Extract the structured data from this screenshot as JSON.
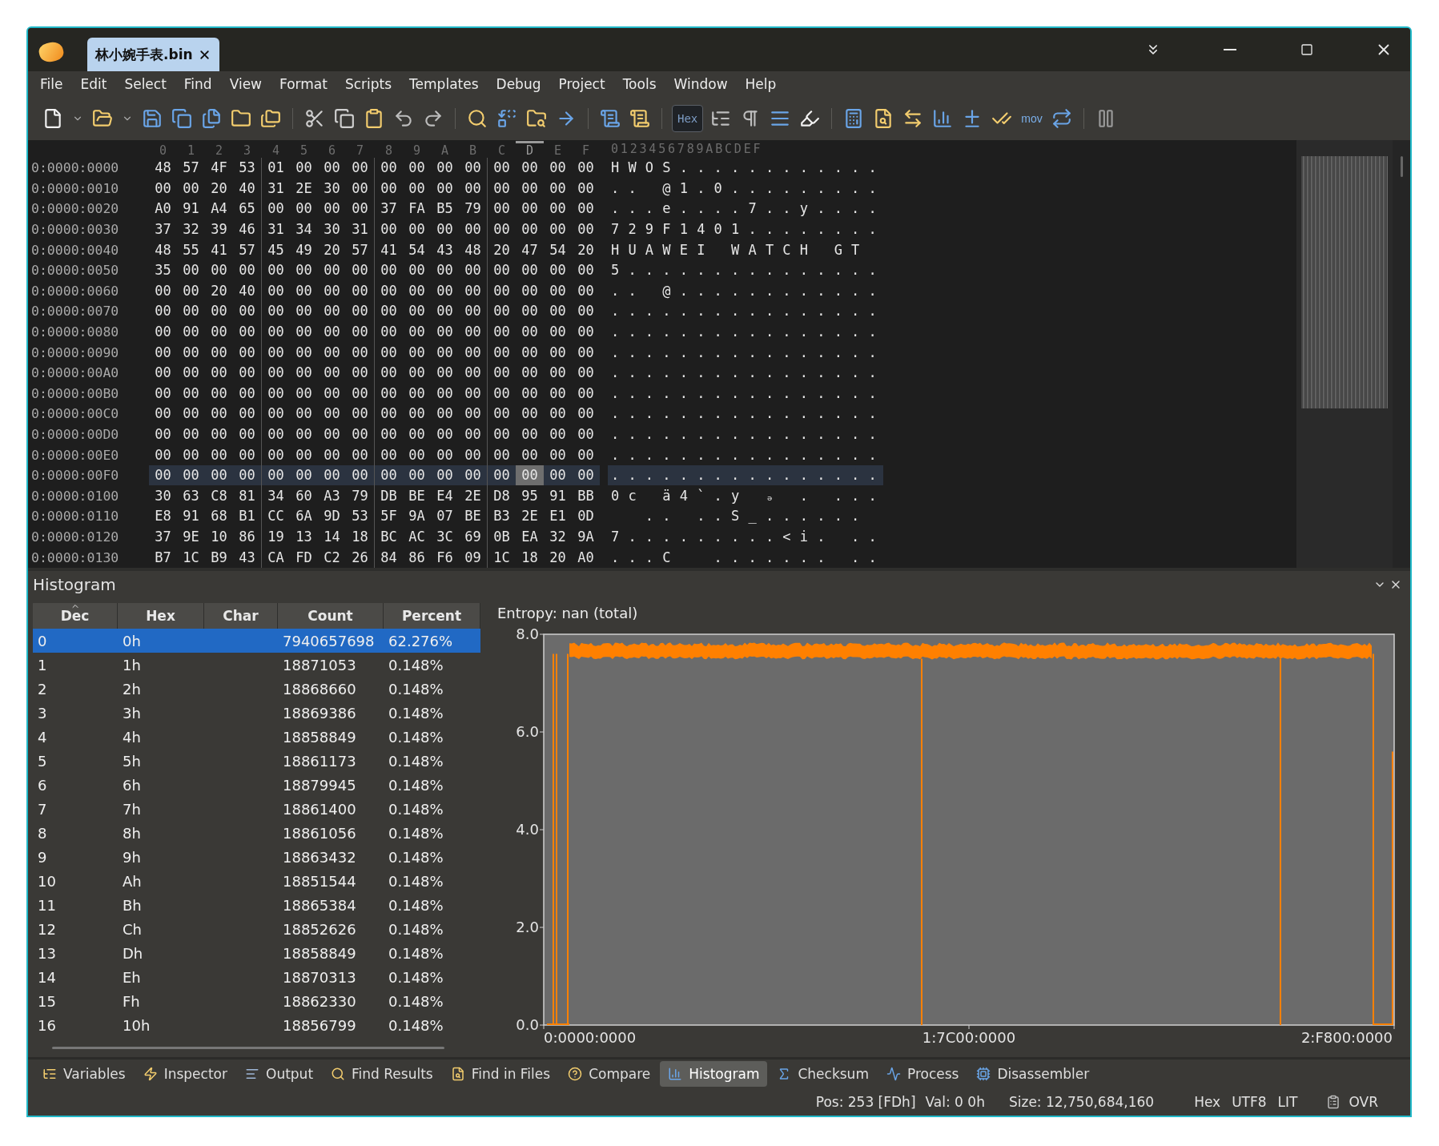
{
  "window": {
    "tab": {
      "title": "林小婉手表.bin",
      "selected": true
    }
  },
  "menu": [
    "File",
    "Edit",
    "Select",
    "Find",
    "View",
    "Format",
    "Scripts",
    "Templates",
    "Debug",
    "Project",
    "Tools",
    "Window",
    "Help"
  ],
  "toolbar": {
    "hex_button": {
      "label": "Hex",
      "on": true
    },
    "mov_label": "mov"
  },
  "hex_view": {
    "header": [
      {
        "label": "0",
        "selected": false
      },
      {
        "label": "1",
        "selected": false
      },
      {
        "label": "2",
        "selected": false
      },
      {
        "label": "3",
        "selected": false
      },
      {
        "label": "4",
        "selected": false
      },
      {
        "label": "5",
        "selected": false
      },
      {
        "label": "6",
        "selected": false
      },
      {
        "label": "7",
        "selected": false
      },
      {
        "label": "8",
        "selected": false
      },
      {
        "label": "9",
        "selected": false
      },
      {
        "label": "A",
        "selected": false
      },
      {
        "label": "B",
        "selected": false
      },
      {
        "label": "C",
        "selected": false
      },
      {
        "label": "D",
        "selected": true
      },
      {
        "label": "E",
        "selected": false
      },
      {
        "label": "F",
        "selected": false
      }
    ],
    "ascii_header": "0123456789ABCDEF",
    "rows": [
      {
        "address": "0:0000:0000",
        "bytes": [
          "48",
          "57",
          "4F",
          "53",
          "01",
          "00",
          "00",
          "00",
          "00",
          "00",
          "00",
          "00",
          "00",
          "00",
          "00",
          "00"
        ],
        "ascii": "HWOS............",
        "selected": false
      },
      {
        "address": "0:0000:0010",
        "bytes": [
          "00",
          "00",
          "20",
          "40",
          "31",
          "2E",
          "30",
          "00",
          "00",
          "00",
          "00",
          "00",
          "00",
          "00",
          "00",
          "00"
        ],
        "ascii": ".. @1.0.........",
        "selected": false
      },
      {
        "address": "0:0000:0020",
        "bytes": [
          "A0",
          "91",
          "A4",
          "65",
          "00",
          "00",
          "00",
          "00",
          "37",
          "FA",
          "B5",
          "79",
          "00",
          "00",
          "00",
          "00"
        ],
        "ascii": "...e....7..y....",
        "selected": false
      },
      {
        "address": "0:0000:0030",
        "bytes": [
          "37",
          "32",
          "39",
          "46",
          "31",
          "34",
          "30",
          "31",
          "00",
          "00",
          "00",
          "00",
          "00",
          "00",
          "00",
          "00"
        ],
        "ascii": "729F1401........",
        "selected": false
      },
      {
        "address": "0:0000:0040",
        "bytes": [
          "48",
          "55",
          "41",
          "57",
          "45",
          "49",
          "20",
          "57",
          "41",
          "54",
          "43",
          "48",
          "20",
          "47",
          "54",
          "20"
        ],
        "ascii": "HUAWEI WATCH GT",
        "selected": false
      },
      {
        "address": "0:0000:0050",
        "bytes": [
          "35",
          "00",
          "00",
          "00",
          "00",
          "00",
          "00",
          "00",
          "00",
          "00",
          "00",
          "00",
          "00",
          "00",
          "00",
          "00"
        ],
        "ascii": "5...............",
        "selected": false
      },
      {
        "address": "0:0000:0060",
        "bytes": [
          "00",
          "00",
          "20",
          "40",
          "00",
          "00",
          "00",
          "00",
          "00",
          "00",
          "00",
          "00",
          "00",
          "00",
          "00",
          "00"
        ],
        "ascii": ".. @............",
        "selected": false
      },
      {
        "address": "0:0000:0070",
        "bytes": [
          "00",
          "00",
          "00",
          "00",
          "00",
          "00",
          "00",
          "00",
          "00",
          "00",
          "00",
          "00",
          "00",
          "00",
          "00",
          "00"
        ],
        "ascii": "................",
        "selected": false
      },
      {
        "address": "0:0000:0080",
        "bytes": [
          "00",
          "00",
          "00",
          "00",
          "00",
          "00",
          "00",
          "00",
          "00",
          "00",
          "00",
          "00",
          "00",
          "00",
          "00",
          "00"
        ],
        "ascii": "................",
        "selected": false
      },
      {
        "address": "0:0000:0090",
        "bytes": [
          "00",
          "00",
          "00",
          "00",
          "00",
          "00",
          "00",
          "00",
          "00",
          "00",
          "00",
          "00",
          "00",
          "00",
          "00",
          "00"
        ],
        "ascii": "................",
        "selected": false
      },
      {
        "address": "0:0000:00A0",
        "bytes": [
          "00",
          "00",
          "00",
          "00",
          "00",
          "00",
          "00",
          "00",
          "00",
          "00",
          "00",
          "00",
          "00",
          "00",
          "00",
          "00"
        ],
        "ascii": "................",
        "selected": false
      },
      {
        "address": "0:0000:00B0",
        "bytes": [
          "00",
          "00",
          "00",
          "00",
          "00",
          "00",
          "00",
          "00",
          "00",
          "00",
          "00",
          "00",
          "00",
          "00",
          "00",
          "00"
        ],
        "ascii": "................",
        "selected": false
      },
      {
        "address": "0:0000:00C0",
        "bytes": [
          "00",
          "00",
          "00",
          "00",
          "00",
          "00",
          "00",
          "00",
          "00",
          "00",
          "00",
          "00",
          "00",
          "00",
          "00",
          "00"
        ],
        "ascii": "................",
        "selected": false
      },
      {
        "address": "0:0000:00D0",
        "bytes": [
          "00",
          "00",
          "00",
          "00",
          "00",
          "00",
          "00",
          "00",
          "00",
          "00",
          "00",
          "00",
          "00",
          "00",
          "00",
          "00"
        ],
        "ascii": "................",
        "selected": false
      },
      {
        "address": "0:0000:00E0",
        "bytes": [
          "00",
          "00",
          "00",
          "00",
          "00",
          "00",
          "00",
          "00",
          "00",
          "00",
          "00",
          "00",
          "00",
          "00",
          "00",
          "00"
        ],
        "ascii": "................",
        "selected": false
      },
      {
        "address": "0:0000:00F0",
        "bytes": [
          "00",
          "00",
          "00",
          "00",
          "00",
          "00",
          "00",
          "00",
          "00",
          "00",
          "00",
          "00",
          "00",
          "00",
          "00",
          "00"
        ],
        "ascii": "................",
        "selected": true
      },
      {
        "address": "0:0000:0100",
        "bytes": [
          "30",
          "63",
          "C8",
          "81",
          "34",
          "60",
          "A3",
          "79",
          "DB",
          "BE",
          "E4",
          "2E",
          "D8",
          "95",
          "91",
          "BB"
        ],
        "ascii": "0c ä4`.y ₔ . ...",
        "selected": false
      },
      {
        "address": "0:0000:0110",
        "bytes": [
          "E8",
          "91",
          "68",
          "B1",
          "CC",
          "6A",
          "9D",
          "53",
          "5F",
          "9A",
          "07",
          "BE",
          "B3",
          "2E",
          "E1",
          "0D"
        ],
        "ascii": "  .. ..S_......",
        "selected": false
      },
      {
        "address": "0:0000:0120",
        "bytes": [
          "37",
          "9E",
          "10",
          "86",
          "19",
          "13",
          "14",
          "18",
          "BC",
          "AC",
          "3C",
          "69",
          "0B",
          "EA",
          "32",
          "9A"
        ],
        "ascii": "7.........<i. ..",
        "selected": false
      },
      {
        "address": "0:0000:0130",
        "bytes": [
          "B7",
          "1C",
          "B9",
          "43",
          "CA",
          "FD",
          "C2",
          "26",
          "84",
          "86",
          "F6",
          "09",
          "1C",
          "18",
          "20",
          "A0"
        ],
        "ascii": "...C  ....... ..",
        "selected": false
      }
    ]
  },
  "histogram": {
    "title": "Histogram",
    "columns": [
      {
        "label": "Dec",
        "sorted": true
      },
      {
        "label": "Hex",
        "sorted": false
      },
      {
        "label": "Char",
        "sorted": false
      },
      {
        "label": "Count",
        "sorted": false
      },
      {
        "label": "Percent",
        "sorted": false
      }
    ],
    "rows": [
      {
        "dec": "0",
        "hex": "0h",
        "count": "7940657698",
        "percent": "62.276%",
        "selected": true
      },
      {
        "dec": "1",
        "hex": "1h",
        "count": "18871053",
        "percent": "0.148%",
        "selected": false
      },
      {
        "dec": "2",
        "hex": "2h",
        "count": "18868660",
        "percent": "0.148%",
        "selected": false
      },
      {
        "dec": "3",
        "hex": "3h",
        "count": "18869386",
        "percent": "0.148%",
        "selected": false
      },
      {
        "dec": "4",
        "hex": "4h",
        "count": "18858849",
        "percent": "0.148%",
        "selected": false
      },
      {
        "dec": "5",
        "hex": "5h",
        "count": "18861173",
        "percent": "0.148%",
        "selected": false
      },
      {
        "dec": "6",
        "hex": "6h",
        "count": "18879945",
        "percent": "0.148%",
        "selected": false
      },
      {
        "dec": "7",
        "hex": "7h",
        "count": "18861400",
        "percent": "0.148%",
        "selected": false
      },
      {
        "dec": "8",
        "hex": "8h",
        "count": "18861056",
        "percent": "0.148%",
        "selected": false
      },
      {
        "dec": "9",
        "hex": "9h",
        "count": "18863432",
        "percent": "0.148%",
        "selected": false
      },
      {
        "dec": "10",
        "hex": "Ah",
        "count": "18851544",
        "percent": "0.148%",
        "selected": false
      },
      {
        "dec": "11",
        "hex": "Bh",
        "count": "18865384",
        "percent": "0.148%",
        "selected": false
      },
      {
        "dec": "12",
        "hex": "Ch",
        "count": "18852626",
        "percent": "0.148%",
        "selected": false
      },
      {
        "dec": "13",
        "hex": "Dh",
        "count": "18858849",
        "percent": "0.148%",
        "selected": false
      },
      {
        "dec": "14",
        "hex": "Eh",
        "count": "18870313",
        "percent": "0.148%",
        "selected": false
      },
      {
        "dec": "15",
        "hex": "Fh",
        "count": "18862330",
        "percent": "0.148%",
        "selected": false
      },
      {
        "dec": "16",
        "hex": "10h",
        "count": "18856799",
        "percent": "0.148%",
        "selected": false
      }
    ],
    "entropy_label": "Entropy: nan (total)",
    "y_ticks": [
      "8.0",
      "6.0",
      "4.0",
      "2.0",
      "0.0"
    ],
    "x_ticks": [
      "0:0000:0000",
      "1:7C00:0000",
      "2:F800:0000"
    ]
  },
  "bottom_tabs": [
    {
      "label": "Variables",
      "selected": false
    },
    {
      "label": "Inspector",
      "selected": false
    },
    {
      "label": "Output",
      "selected": false
    },
    {
      "label": "Find Results",
      "selected": false
    },
    {
      "label": "Find in Files",
      "selected": false
    },
    {
      "label": "Compare",
      "selected": false
    },
    {
      "label": "Histogram",
      "selected": true
    },
    {
      "label": "Checksum",
      "selected": false
    },
    {
      "label": "Process",
      "selected": false
    },
    {
      "label": "Disassembler",
      "selected": false
    }
  ],
  "status_bar": {
    "position": "Pos: 253 [FDh]",
    "value": "Val: 0 0h",
    "size": "Size: 12,750,684,160",
    "mode": [
      "Hex",
      "UTF8",
      "LIT"
    ],
    "overwrite": "OVR"
  }
}
